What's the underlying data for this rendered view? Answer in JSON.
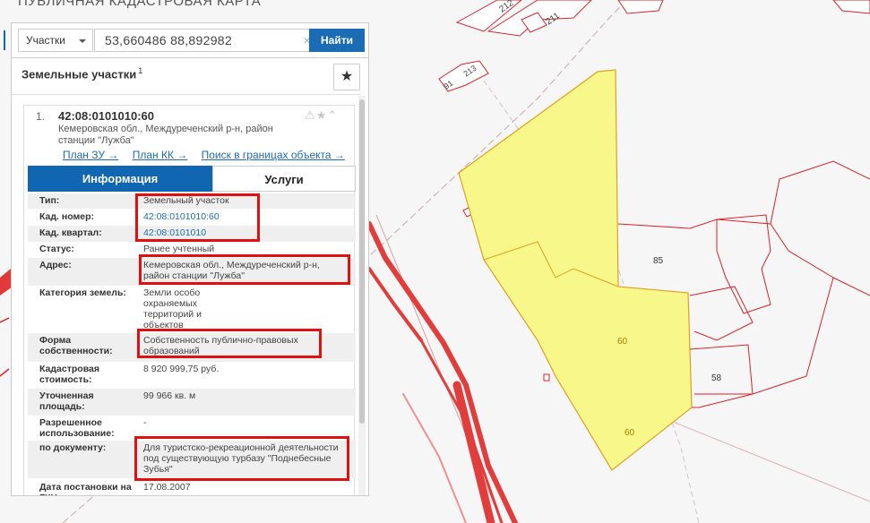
{
  "app": {
    "title": "ПУБЛИЧНАЯ КАДАСТРОВАЯ КАРТА"
  },
  "search": {
    "type_label": "Участки",
    "query": "53,660486 88,892982",
    "clear_icon": "×",
    "button_label": "Найти"
  },
  "panel": {
    "header": "Земельные участки",
    "count": "1",
    "star_icon": "★"
  },
  "result": {
    "index": "1.",
    "cad_number": "42:08:0101010:60",
    "address": "Кемеровская обл., Междуреченский р-н, район станции \"Лужба\"",
    "action_icons": "⚠★⌃",
    "links": [
      "План ЗУ →",
      "План КК →",
      "Поиск в границах объекта →"
    ],
    "tabs": [
      "Информация",
      "Услуги"
    ],
    "rows": [
      {
        "label": "Тип:",
        "value": "Земельный участок"
      },
      {
        "label": "Кад. номер:",
        "value": "42:08:0101010:60"
      },
      {
        "label": "Кад. квартал:",
        "value": "42:08:0101010"
      },
      {
        "label": "Статус:",
        "value": "Ранее учтенный"
      },
      {
        "label": "Адрес:",
        "value": "Кемеровская обл., Междуреченский р-н, район станции \"Лужба\""
      },
      {
        "label": "Категория земель:",
        "value": "Земли особо охраняемых территорий и объектов"
      },
      {
        "label": "Форма собственности:",
        "value": "Собственность публично-правовых образований"
      },
      {
        "label": "Кадастровая стоимость:",
        "value": "8 920 999,75 руб."
      },
      {
        "label": "Уточненная площадь:",
        "value": "99 966 кв. м"
      },
      {
        "label": "Разрешенное использование:",
        "value": "-"
      },
      {
        "label": "по документу:",
        "value": "Для туристско-рекреационной деятельности под существующую турбазу \"Поднебесные Зубья\""
      },
      {
        "label": "Дата постановки на ГКН:",
        "value": "17.08.2007"
      }
    ]
  },
  "map": {
    "parcel_color": "#f7f78a",
    "outline_color": "#d9232b",
    "labels": {
      "p212": "212",
      "p211": "211",
      "p213": "213",
      "p91": "91",
      "p85": "85",
      "p58": "58",
      "p60a": "60",
      "p60b": "60"
    }
  }
}
